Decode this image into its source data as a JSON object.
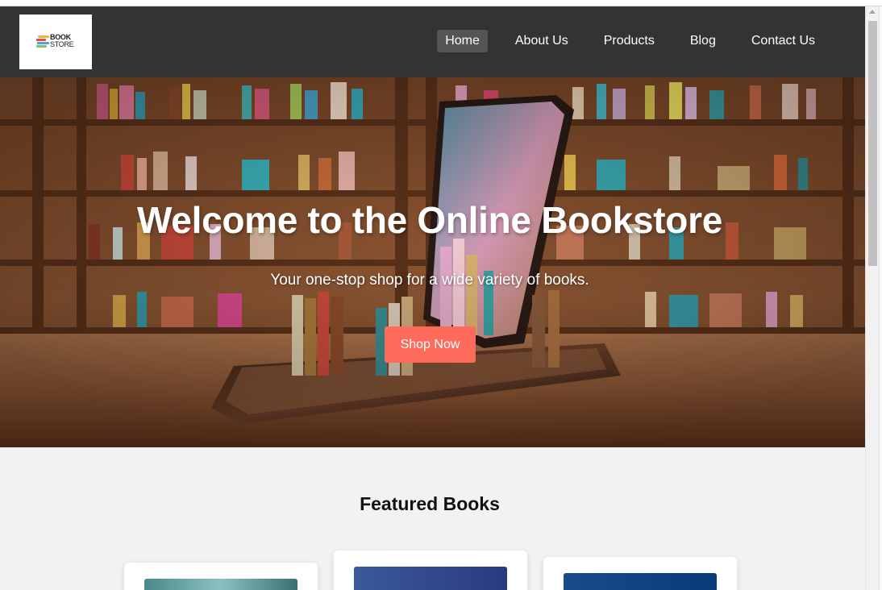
{
  "brand": {
    "logo_line1": "BOOK",
    "logo_line2": "STORE",
    "logo_colors": [
      "#f5b335",
      "#e94c3d",
      "#4aa3df",
      "#7cc576"
    ]
  },
  "nav": {
    "items": [
      {
        "label": "Home",
        "active": true
      },
      {
        "label": "About Us",
        "active": false
      },
      {
        "label": "Products",
        "active": false
      },
      {
        "label": "Blog",
        "active": false
      },
      {
        "label": "Contact Us",
        "active": false
      }
    ]
  },
  "hero": {
    "title": "Welcome to the Online Bookstore",
    "subtitle": "Your one-stop shop for a wide variety of books.",
    "cta_label": "Shop Now",
    "cta_color": "#ff6b5b"
  },
  "featured": {
    "title": "Featured Books"
  },
  "colors": {
    "header_bg": "#333333",
    "page_bg": "#f2f2f2",
    "nav_active_bg": "#555555"
  }
}
